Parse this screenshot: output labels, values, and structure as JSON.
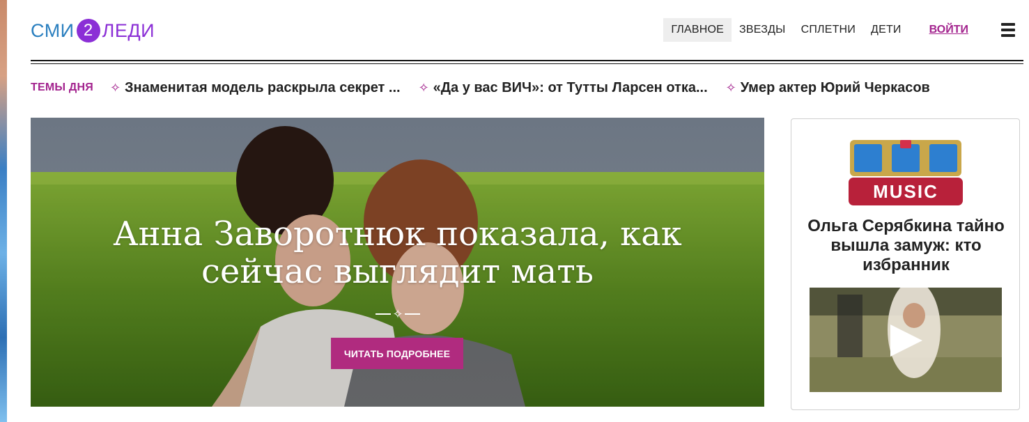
{
  "logo": {
    "left": "СМИ",
    "number": "2",
    "right": "ЛЕДИ"
  },
  "nav": {
    "items": [
      {
        "label": "ГЛАВНОЕ",
        "active": true
      },
      {
        "label": "ЗВЕЗДЫ",
        "active": false
      },
      {
        "label": "СПЛЕТНИ",
        "active": false
      },
      {
        "label": "ДЕТИ",
        "active": false
      }
    ],
    "login_label": "ВОЙТИ",
    "menu_icon": "hamburger-icon"
  },
  "topics": {
    "label": "ТЕМЫ ДНЯ",
    "star_icon": "sparkle-icon",
    "items": [
      "Знаменитая модель раскрыла секрет ...",
      "«Да у вас ВИЧ»: от Тутты Ларсен отка...",
      "Умер актер Юрий Черкасов"
    ]
  },
  "hero": {
    "title": "Анна Заворотнюк показала, как сейчас выглядит мать",
    "divider_glyph": "✧",
    "button_label": "ЧИТАТЬ ПОДРОБНЕЕ"
  },
  "sidebar": {
    "brand_logo_text": "ТНТ MUSIC",
    "title": "Ольга Серябкина тайно вышла замуж: кто избранник",
    "video_icon": "play-icon"
  },
  "colors": {
    "accent": "#a3238e",
    "button": "#b02b7f",
    "logo_blue": "#2a7fbf",
    "logo_purple": "#8b2fd6"
  }
}
